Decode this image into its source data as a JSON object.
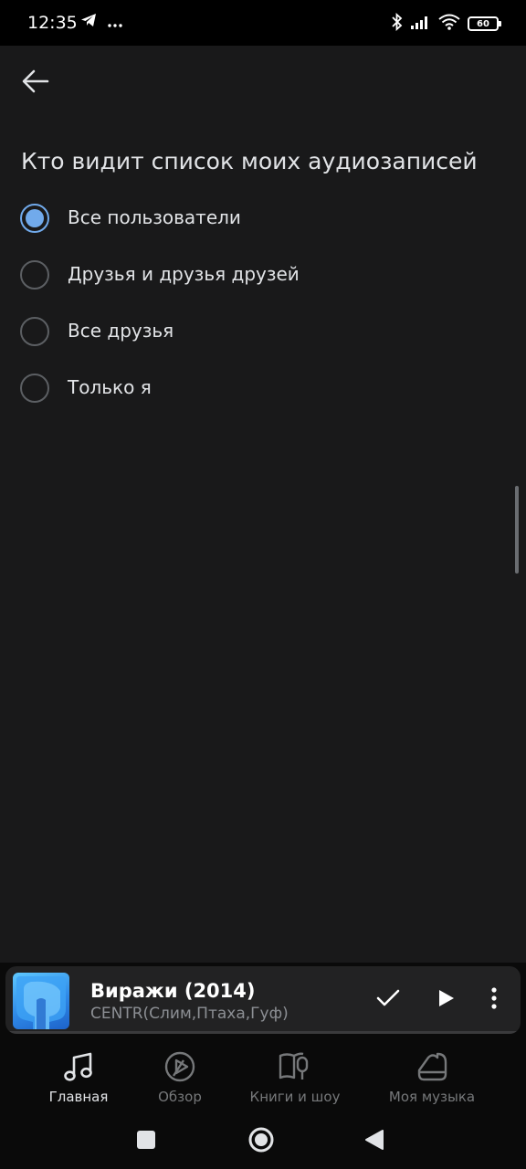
{
  "status_bar": {
    "time": "12:35",
    "battery": "60",
    "left_icons": [
      "telegram-icon",
      "more-dots-icon"
    ],
    "right_icons": [
      "bluetooth-icon",
      "signal-icon",
      "wifi-icon",
      "battery-icon"
    ]
  },
  "page": {
    "title": "Кто видит список моих аудиозаписей",
    "options": [
      {
        "label": "Все пользователи",
        "selected": true
      },
      {
        "label": "Друзья и друзья друзей",
        "selected": false
      },
      {
        "label": "Все друзья",
        "selected": false
      },
      {
        "label": "Только я",
        "selected": false
      }
    ]
  },
  "player": {
    "title": "Виражи (2014)",
    "artist": "CENTR(Слим,Птаха,Гуф)"
  },
  "nav": {
    "items": [
      {
        "label": "Главная",
        "icon": "music-note-icon",
        "active": true
      },
      {
        "label": "Обзор",
        "icon": "explore-icon",
        "active": false
      },
      {
        "label": "Книги и шоу",
        "icon": "book-mic-icon",
        "active": false
      },
      {
        "label": "Моя музыка",
        "icon": "my-music-icon",
        "active": false
      }
    ]
  },
  "colors": {
    "accent": "#71aaeb",
    "background": "#19191a",
    "text": "#e1e3e6",
    "muted": "#76787a"
  }
}
